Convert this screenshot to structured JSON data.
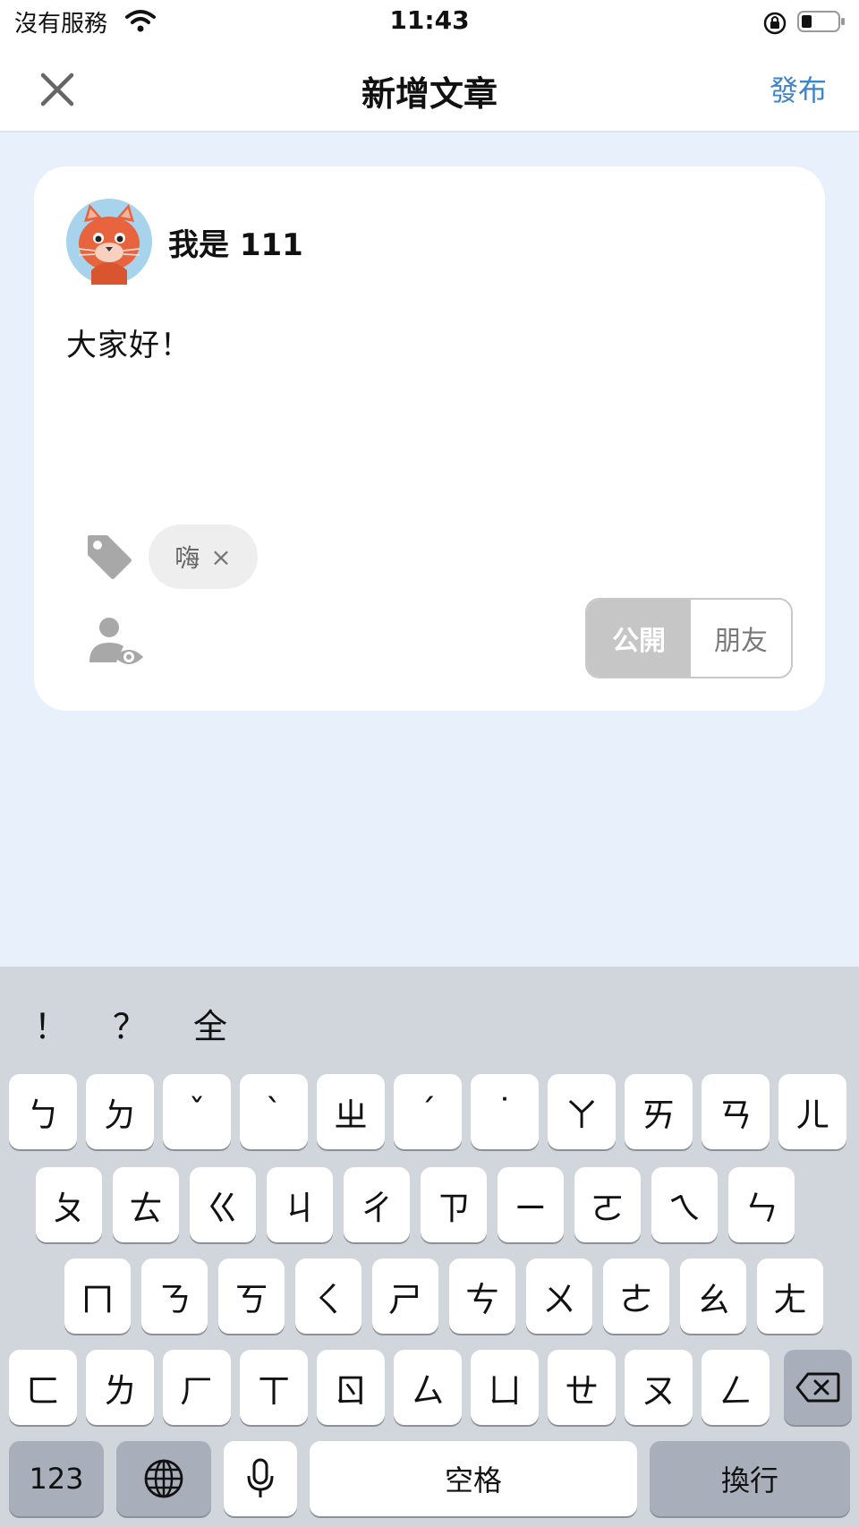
{
  "status_bar": {
    "carrier": "沒有服務",
    "time": "11:43"
  },
  "nav": {
    "title": "新增文章",
    "publish_label": "發布"
  },
  "post": {
    "username": "我是 111",
    "text": "大家好！",
    "tags": [
      {
        "label": "嗨",
        "remove": "×"
      }
    ],
    "visibility": {
      "options": [
        "公開",
        "朋友"
      ],
      "selected": "公開"
    }
  },
  "keyboard": {
    "suggestions": [
      "！",
      "？",
      "全"
    ],
    "row1": [
      "ㄅ",
      "ㄉ",
      "ˇ",
      "ˋ",
      "ㄓ",
      "ˊ",
      "˙",
      "ㄚ",
      "ㄞ",
      "ㄢ",
      "ㄦ"
    ],
    "row2": [
      "ㄆ",
      "ㄊ",
      "ㄍ",
      "ㄐ",
      "ㄔ",
      "ㄗ",
      "ㄧ",
      "ㄛ",
      "ㄟ",
      "ㄣ"
    ],
    "row3": [
      "ㄇ",
      "ㄋ",
      "ㄎ",
      "ㄑ",
      "ㄕ",
      "ㄘ",
      "ㄨ",
      "ㄜ",
      "ㄠ",
      "ㄤ"
    ],
    "row4": [
      "ㄈ",
      "ㄌ",
      "ㄏ",
      "ㄒ",
      "ㄖ",
      "ㄙ",
      "ㄩ",
      "ㄝ",
      "ㄡ",
      "ㄥ"
    ],
    "numbers_label": "123",
    "space_label": "空格",
    "return_label": "換行"
  }
}
